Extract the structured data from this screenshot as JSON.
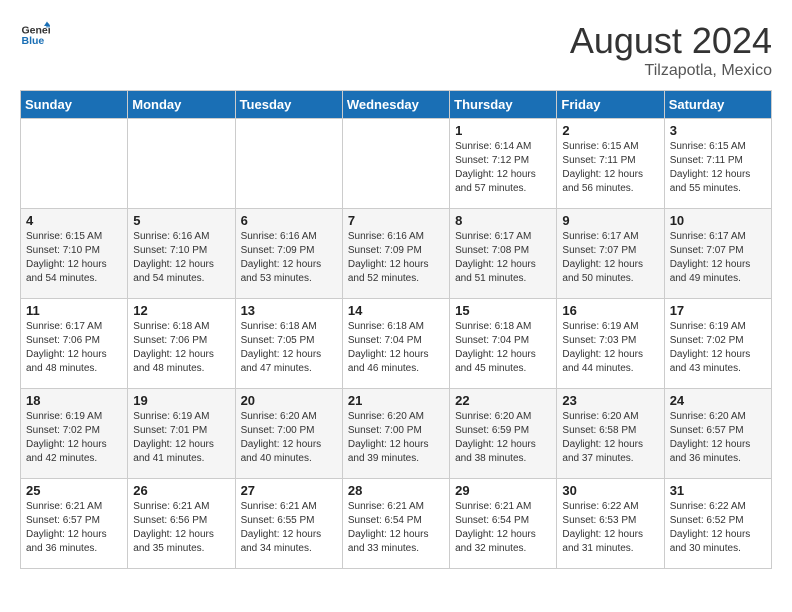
{
  "header": {
    "logo_general": "General",
    "logo_blue": "Blue",
    "month_year": "August 2024",
    "location": "Tilzapotla, Mexico"
  },
  "days_of_week": [
    "Sunday",
    "Monday",
    "Tuesday",
    "Wednesday",
    "Thursday",
    "Friday",
    "Saturday"
  ],
  "weeks": [
    [
      {
        "day": "",
        "info": ""
      },
      {
        "day": "",
        "info": ""
      },
      {
        "day": "",
        "info": ""
      },
      {
        "day": "",
        "info": ""
      },
      {
        "day": "1",
        "info": "Sunrise: 6:14 AM\nSunset: 7:12 PM\nDaylight: 12 hours\nand 57 minutes."
      },
      {
        "day": "2",
        "info": "Sunrise: 6:15 AM\nSunset: 7:11 PM\nDaylight: 12 hours\nand 56 minutes."
      },
      {
        "day": "3",
        "info": "Sunrise: 6:15 AM\nSunset: 7:11 PM\nDaylight: 12 hours\nand 55 minutes."
      }
    ],
    [
      {
        "day": "4",
        "info": "Sunrise: 6:15 AM\nSunset: 7:10 PM\nDaylight: 12 hours\nand 54 minutes."
      },
      {
        "day": "5",
        "info": "Sunrise: 6:16 AM\nSunset: 7:10 PM\nDaylight: 12 hours\nand 54 minutes."
      },
      {
        "day": "6",
        "info": "Sunrise: 6:16 AM\nSunset: 7:09 PM\nDaylight: 12 hours\nand 53 minutes."
      },
      {
        "day": "7",
        "info": "Sunrise: 6:16 AM\nSunset: 7:09 PM\nDaylight: 12 hours\nand 52 minutes."
      },
      {
        "day": "8",
        "info": "Sunrise: 6:17 AM\nSunset: 7:08 PM\nDaylight: 12 hours\nand 51 minutes."
      },
      {
        "day": "9",
        "info": "Sunrise: 6:17 AM\nSunset: 7:07 PM\nDaylight: 12 hours\nand 50 minutes."
      },
      {
        "day": "10",
        "info": "Sunrise: 6:17 AM\nSunset: 7:07 PM\nDaylight: 12 hours\nand 49 minutes."
      }
    ],
    [
      {
        "day": "11",
        "info": "Sunrise: 6:17 AM\nSunset: 7:06 PM\nDaylight: 12 hours\nand 48 minutes."
      },
      {
        "day": "12",
        "info": "Sunrise: 6:18 AM\nSunset: 7:06 PM\nDaylight: 12 hours\nand 48 minutes."
      },
      {
        "day": "13",
        "info": "Sunrise: 6:18 AM\nSunset: 7:05 PM\nDaylight: 12 hours\nand 47 minutes."
      },
      {
        "day": "14",
        "info": "Sunrise: 6:18 AM\nSunset: 7:04 PM\nDaylight: 12 hours\nand 46 minutes."
      },
      {
        "day": "15",
        "info": "Sunrise: 6:18 AM\nSunset: 7:04 PM\nDaylight: 12 hours\nand 45 minutes."
      },
      {
        "day": "16",
        "info": "Sunrise: 6:19 AM\nSunset: 7:03 PM\nDaylight: 12 hours\nand 44 minutes."
      },
      {
        "day": "17",
        "info": "Sunrise: 6:19 AM\nSunset: 7:02 PM\nDaylight: 12 hours\nand 43 minutes."
      }
    ],
    [
      {
        "day": "18",
        "info": "Sunrise: 6:19 AM\nSunset: 7:02 PM\nDaylight: 12 hours\nand 42 minutes."
      },
      {
        "day": "19",
        "info": "Sunrise: 6:19 AM\nSunset: 7:01 PM\nDaylight: 12 hours\nand 41 minutes."
      },
      {
        "day": "20",
        "info": "Sunrise: 6:20 AM\nSunset: 7:00 PM\nDaylight: 12 hours\nand 40 minutes."
      },
      {
        "day": "21",
        "info": "Sunrise: 6:20 AM\nSunset: 7:00 PM\nDaylight: 12 hours\nand 39 minutes."
      },
      {
        "day": "22",
        "info": "Sunrise: 6:20 AM\nSunset: 6:59 PM\nDaylight: 12 hours\nand 38 minutes."
      },
      {
        "day": "23",
        "info": "Sunrise: 6:20 AM\nSunset: 6:58 PM\nDaylight: 12 hours\nand 37 minutes."
      },
      {
        "day": "24",
        "info": "Sunrise: 6:20 AM\nSunset: 6:57 PM\nDaylight: 12 hours\nand 36 minutes."
      }
    ],
    [
      {
        "day": "25",
        "info": "Sunrise: 6:21 AM\nSunset: 6:57 PM\nDaylight: 12 hours\nand 36 minutes."
      },
      {
        "day": "26",
        "info": "Sunrise: 6:21 AM\nSunset: 6:56 PM\nDaylight: 12 hours\nand 35 minutes."
      },
      {
        "day": "27",
        "info": "Sunrise: 6:21 AM\nSunset: 6:55 PM\nDaylight: 12 hours\nand 34 minutes."
      },
      {
        "day": "28",
        "info": "Sunrise: 6:21 AM\nSunset: 6:54 PM\nDaylight: 12 hours\nand 33 minutes."
      },
      {
        "day": "29",
        "info": "Sunrise: 6:21 AM\nSunset: 6:54 PM\nDaylight: 12 hours\nand 32 minutes."
      },
      {
        "day": "30",
        "info": "Sunrise: 6:22 AM\nSunset: 6:53 PM\nDaylight: 12 hours\nand 31 minutes."
      },
      {
        "day": "31",
        "info": "Sunrise: 6:22 AM\nSunset: 6:52 PM\nDaylight: 12 hours\nand 30 minutes."
      }
    ]
  ]
}
